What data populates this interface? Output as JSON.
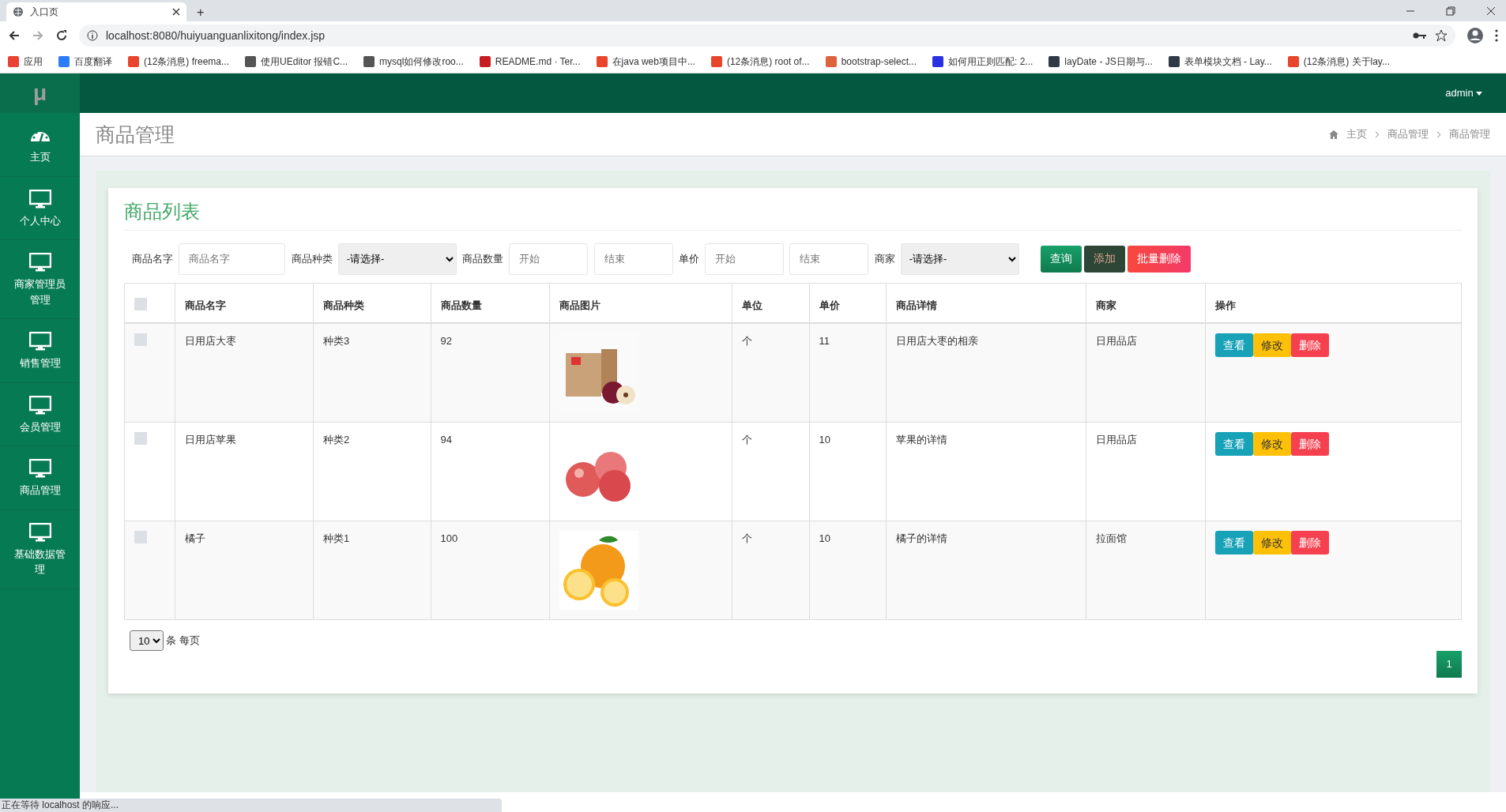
{
  "browser": {
    "tab_title": "入口页",
    "new_tab": "+",
    "url": "localhost:8080/huiyuanguanlixitong/index.jsp",
    "bookmarks": [
      {
        "label": "应用",
        "color": "#ea4335"
      },
      {
        "label": "百度翻译",
        "color": "#2b7cf6"
      },
      {
        "label": "(12条消息) freema...",
        "color": "#e8452c"
      },
      {
        "label": "使用UEditor 报错C...",
        "color": "#555555"
      },
      {
        "label": "mysql如何修改roo...",
        "color": "#555555"
      },
      {
        "label": "README.md · Ter...",
        "color": "#c71d23"
      },
      {
        "label": "在java web项目中...",
        "color": "#e8452c"
      },
      {
        "label": "(12条消息) root of...",
        "color": "#e8452c"
      },
      {
        "label": "bootstrap-select...",
        "color": "#e0623d"
      },
      {
        "label": "如何用正则匹配: 2...",
        "color": "#2932e1"
      },
      {
        "label": "layDate - JS日期与...",
        "color": "#2f3a46"
      },
      {
        "label": "表单模块文档 - Lay...",
        "color": "#2f3a46"
      },
      {
        "label": "(12条消息) 关于lay...",
        "color": "#e8452c"
      }
    ]
  },
  "app": {
    "logo": "μ",
    "user": "admin"
  },
  "sidebar": {
    "items": [
      {
        "label": "主页",
        "kind": "dashboard"
      },
      {
        "label": "个人中心",
        "kind": "monitor"
      },
      {
        "label": "商家管理员管理",
        "kind": "monitor"
      },
      {
        "label": "销售管理",
        "kind": "monitor"
      },
      {
        "label": "会员管理",
        "kind": "monitor"
      },
      {
        "label": "商品管理",
        "kind": "monitor"
      },
      {
        "label": "基础数据管理",
        "kind": "monitor"
      }
    ]
  },
  "page_title": "商品管理",
  "breadcrumb": [
    "主页",
    "商品管理",
    "商品管理"
  ],
  "panel_title": "商品列表",
  "filters": [
    {
      "kind": "text",
      "label": "商品名字",
      "placeholder": "商品名字"
    },
    {
      "kind": "select",
      "label": "商品种类",
      "value": "-请选择-"
    },
    {
      "kind": "range",
      "label": "商品数量",
      "from_placeholder": "开始",
      "to_placeholder": "结束"
    },
    {
      "kind": "range",
      "label": "单价",
      "from_placeholder": "开始",
      "to_placeholder": "结束"
    },
    {
      "kind": "select",
      "label": "商家",
      "value": "-请选择-"
    }
  ],
  "buttons": [
    {
      "label": "查询",
      "kind": "query"
    },
    {
      "label": "添加",
      "kind": "add"
    },
    {
      "label": "批量删除",
      "kind": "delete"
    }
  ],
  "table": {
    "select_all": {
      "checked": false
    },
    "columns": [
      "商品名字",
      "商品种类",
      "商品数量",
      "商品图片",
      "单位",
      "单价",
      "商品详情",
      "商家",
      "操作"
    ],
    "rows": [
      {
        "checked": false,
        "name": "日用店大枣",
        "category": "种类3",
        "quantity": "92",
        "unit": "个",
        "price": "11",
        "detail": "日用店大枣的相亲",
        "merchant": "日用品店",
        "actions": [
          {
            "label": "查看",
            "kind": "view"
          },
          {
            "label": "修改",
            "kind": "edit"
          },
          {
            "label": "删除",
            "kind": "delete"
          }
        ]
      },
      {
        "checked": false,
        "name": "日用店苹果",
        "category": "种类2",
        "quantity": "94",
        "unit": "个",
        "price": "10",
        "detail": "苹果的详情",
        "merchant": "日用品店",
        "actions": [
          {
            "label": "查看",
            "kind": "view"
          },
          {
            "label": "修改",
            "kind": "edit"
          },
          {
            "label": "删除",
            "kind": "delete"
          }
        ]
      },
      {
        "checked": false,
        "name": "橘子",
        "category": "种类1",
        "quantity": "100",
        "unit": "个",
        "price": "10",
        "detail": "橘子的详情",
        "merchant": "拉面馆",
        "actions": [
          {
            "label": "查看",
            "kind": "view"
          },
          {
            "label": "修改",
            "kind": "edit"
          },
          {
            "label": "删除",
            "kind": "delete"
          }
        ]
      }
    ]
  },
  "pagination": {
    "page_size": "10",
    "page_size_label": "条 每页",
    "pages": [
      {
        "label": "1",
        "selected": true
      }
    ]
  },
  "status_bar": "正在等待 localhost 的响应..."
}
